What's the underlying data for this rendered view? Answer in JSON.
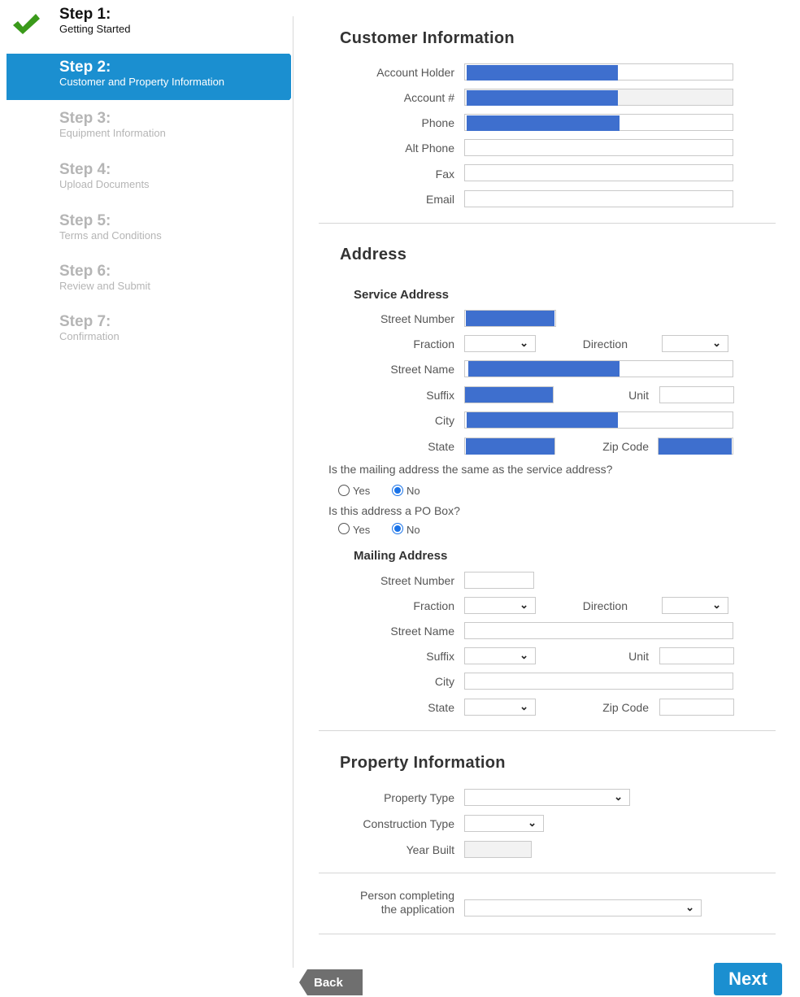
{
  "sidebar": {
    "steps": [
      {
        "num": "Step 1:",
        "desc": "Getting Started"
      },
      {
        "num": "Step 2:",
        "desc": "Customer and Property Information"
      },
      {
        "num": "Step 3:",
        "desc": "Equipment Information"
      },
      {
        "num": "Step 4:",
        "desc": "Upload Documents"
      },
      {
        "num": "Step 5:",
        "desc": "Terms and Conditions"
      },
      {
        "num": "Step 6:",
        "desc": "Review and Submit"
      },
      {
        "num": "Step 7:",
        "desc": "Confirmation"
      }
    ]
  },
  "customer": {
    "title": "Customer Information",
    "account_holder": "Account Holder",
    "account_num": "Account #",
    "phone": "Phone",
    "alt_phone": "Alt Phone",
    "fax": "Fax",
    "email": "Email"
  },
  "address": {
    "title": "Address",
    "service_title": "Service Address",
    "mailing_title": "Mailing Address",
    "street_number": "Street Number",
    "fraction": "Fraction",
    "direction": "Direction",
    "street_name": "Street Name",
    "suffix": "Suffix",
    "unit": "Unit",
    "city": "City",
    "state": "State",
    "zip": "Zip Code",
    "q_same": "Is the mailing address the same as the service address?",
    "q_pobox": "Is this address a PO Box?",
    "yes": "Yes",
    "no": "No"
  },
  "property": {
    "title": "Property Information",
    "property_type": "Property Type",
    "construction_type": "Construction Type",
    "year_built": "Year Built",
    "person_line1": "Person completing",
    "person_line2": "the application"
  },
  "nav": {
    "back": "Back",
    "next": "Next"
  },
  "colors": {
    "accent": "#1b8fd0",
    "redaction": "#3e6fce",
    "check": "#3a9a1a"
  },
  "icons": [
    "check-icon",
    "chevron-down-icon"
  ]
}
